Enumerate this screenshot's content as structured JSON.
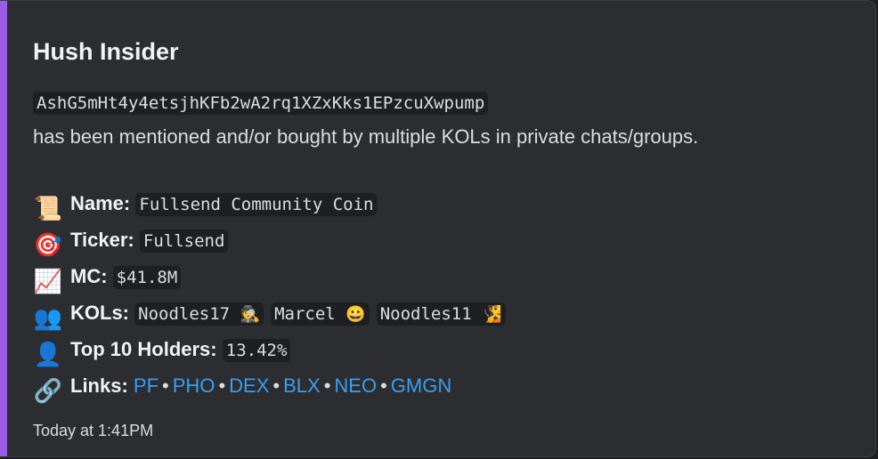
{
  "embed": {
    "title": "Hush Insider",
    "contract_address": "AshG5mHt4y4etsjhKFb2wA2rq1XZxKks1EPzcuXwpump",
    "description": "has been mentioned and/or bought by multiple KOLs in private chats/groups.",
    "accent_color": "#9b5de5",
    "fields": {
      "name": {
        "icon": "scroll-icon",
        "glyph": "📜",
        "label": "Name:",
        "value": "Fullsend Community Coin"
      },
      "ticker": {
        "icon": "target-icon",
        "glyph": "🎯",
        "label": "Ticker:",
        "value": "Fullsend"
      },
      "mc": {
        "icon": "chart-up-icon",
        "glyph": "📈",
        "label": "MC:",
        "value": "$41.8M"
      },
      "kols": {
        "icon": "users-icon",
        "glyph": "👥",
        "label": "KOLs:",
        "items": [
          {
            "name": "Noodles17",
            "emoji": "🕵"
          },
          {
            "name": "Marcel",
            "emoji": "😀"
          },
          {
            "name": "Noodles11",
            "emoji": "🧏"
          }
        ]
      },
      "holders": {
        "icon": "user-icon",
        "glyph": "👤",
        "label": "Top 10 Holders:",
        "value": "13.42%"
      },
      "links": {
        "icon": "link-icon",
        "glyph": "🔗",
        "label": "Links:",
        "items": [
          "PF",
          "PHO",
          "DEX",
          "BLX",
          "NEO",
          "GMGN"
        ],
        "separator": "•"
      }
    },
    "timestamp": "Today at 1:41PM"
  }
}
